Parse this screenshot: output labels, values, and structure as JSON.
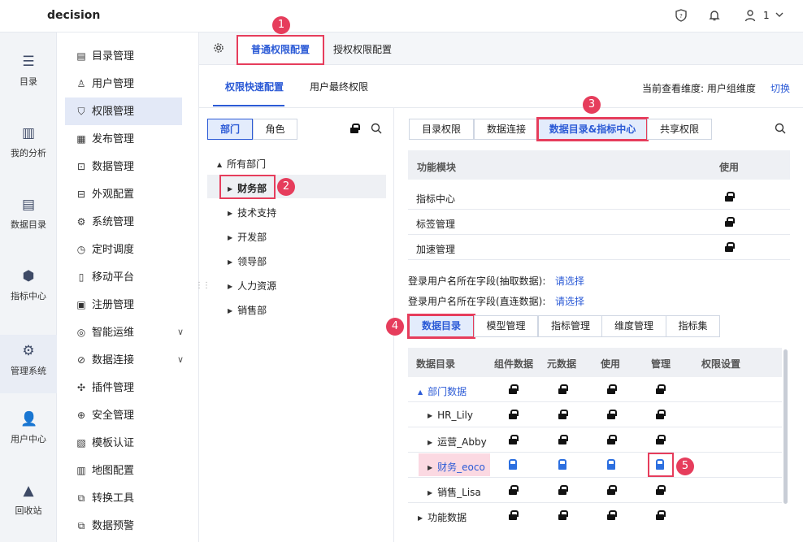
{
  "topbar": {
    "app_name": "decision",
    "user": "1",
    "icons": [
      "shield-icon",
      "bell-icon",
      "user-icon",
      "chevron-down-icon"
    ]
  },
  "nav1": [
    {
      "label": "目录",
      "icon": "catalog-icon"
    },
    {
      "label": "我的分析",
      "icon": "chart-icon"
    },
    {
      "label": "数据目录",
      "icon": "database-icon"
    },
    {
      "label": "指标中心",
      "icon": "cube-icon"
    },
    {
      "label": "管理系统",
      "icon": "gear-icon"
    },
    {
      "label": "用户中心",
      "icon": "users-icon"
    },
    {
      "label": "回收站",
      "icon": "recycle-icon"
    }
  ],
  "nav2": [
    "目录管理",
    "用户管理",
    "权限管理",
    "发布管理",
    "数据管理",
    "外观配置",
    "系统管理",
    "定时调度",
    "移动平台",
    "注册管理",
    "智能运维",
    "数据连接",
    "插件管理",
    "安全管理",
    "模板认证",
    "地图配置",
    "转换工具",
    "数据预警"
  ],
  "tabs1": {
    "tab_a": "普通权限配置",
    "tab_b": "授权权限配置"
  },
  "tabs2": {
    "tab_a": "权限快速配置",
    "tab_b": "用户最终权限",
    "view_label": "当前查看维度: 用户组维度",
    "switch": "切换"
  },
  "left": {
    "seg_a": "部门",
    "seg_b": "角色",
    "root": "所有部门",
    "items": [
      "财务部",
      "技术支持",
      "开发部",
      "领导部",
      "人力资源",
      "销售部"
    ]
  },
  "right_tabs": [
    "目录权限",
    "数据连接",
    "数据目录&指标中心",
    "共享权限"
  ],
  "func_table": {
    "head_module": "功能模块",
    "head_use": "使用",
    "rows": [
      "指标中心",
      "标签管理",
      "加速管理"
    ]
  },
  "login_fields": [
    {
      "label": "登录用户名所在字段(抽取数据):",
      "link": "请选择"
    },
    {
      "label": "登录用户名所在字段(直连数据):",
      "link": "请选择"
    }
  ],
  "sub_tabs": [
    "数据目录",
    "模型管理",
    "指标管理",
    "维度管理",
    "指标集"
  ],
  "data_table": {
    "headers": [
      "数据目录",
      "组件数据",
      "元数据",
      "使用",
      "管理",
      "权限设置"
    ],
    "rows": [
      "部门数据",
      "HR_Lily",
      "运营_Abby",
      "财务_eoco",
      "销售_Lisa",
      "功能数据"
    ]
  },
  "badges": [
    "1",
    "2",
    "3",
    "4",
    "5"
  ],
  "colors": {
    "accent": "#2c5bd6",
    "badge": "#e63d5c",
    "highlight": "#fbd9e2"
  }
}
